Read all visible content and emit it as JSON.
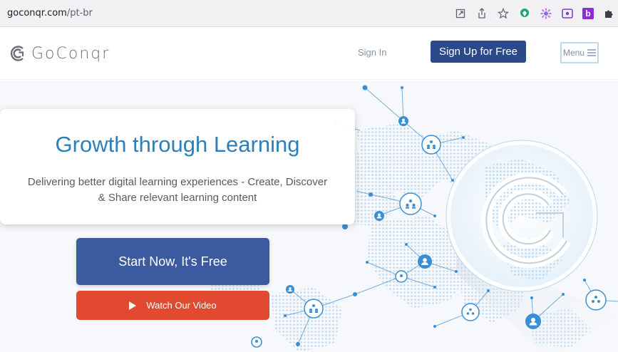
{
  "browser": {
    "url_host": "goconqr.com",
    "url_path": "/pt-br",
    "icons": [
      "open-in-new-icon",
      "share-icon",
      "bookmark-star-icon",
      "extension-green-icon",
      "extension-gear-icon",
      "extension-screen-icon",
      "extension-b-icon",
      "extensions-puzzle-icon"
    ],
    "ext_b_label": "b"
  },
  "header": {
    "logo_text": "GoConqr",
    "sign_in": "Sign In",
    "sign_up": "Sign Up for Free",
    "menu": "Menu"
  },
  "hero": {
    "title": "Growth through Learning",
    "subtitle_line1": "Delivering better digital learning experiences - Create, Discover",
    "subtitle_line2": "& Share relevant learning content",
    "start_button": "Start Now, It's Free",
    "video_button": "Watch Our Video"
  },
  "colors": {
    "brand_blue": "#2b4a8b",
    "start_blue": "#3b5aa0",
    "video_red": "#e14a30",
    "title_blue": "#2c7fb8",
    "node_blue": "#3a8fd4"
  }
}
